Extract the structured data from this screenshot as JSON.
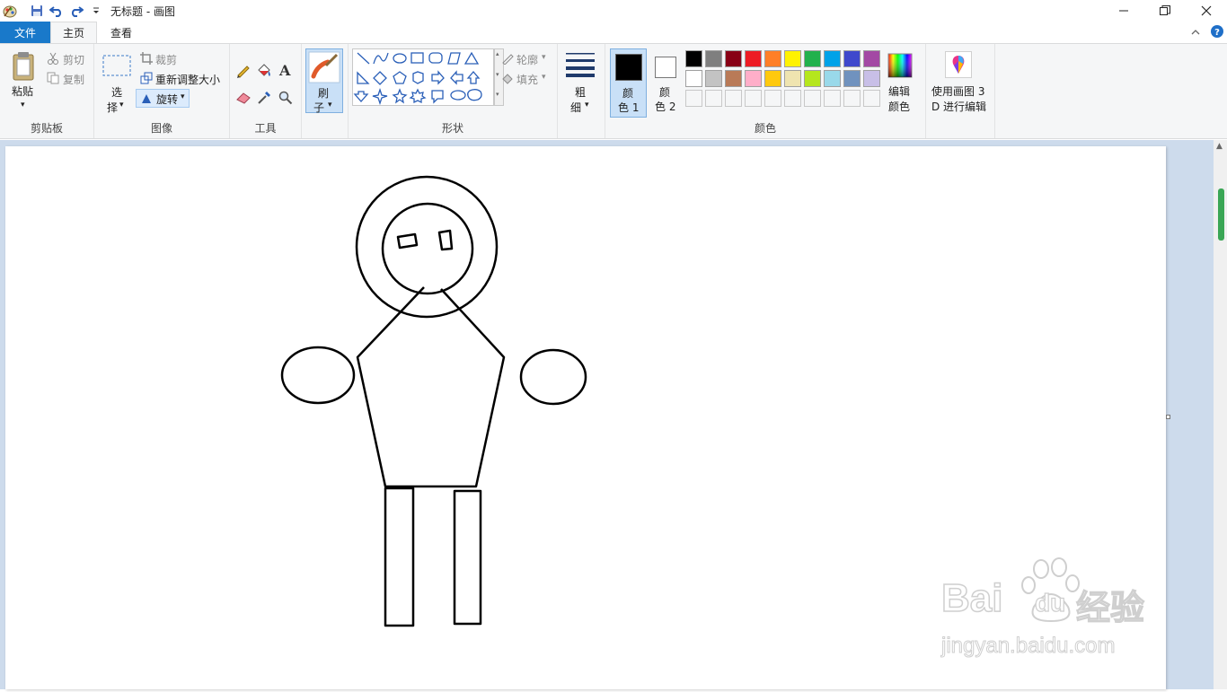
{
  "window": {
    "title": "无标题 - 画图"
  },
  "tabs": {
    "file": "文件",
    "home": "主页",
    "view": "查看"
  },
  "clipboard": {
    "paste": "粘贴",
    "cut": "剪切",
    "copy": "复制",
    "group_label": "剪贴板"
  },
  "image": {
    "select_1": "选",
    "select_2": "择",
    "crop": "裁剪",
    "resize": "重新调整大小",
    "rotate": "旋转",
    "group_label": "图像"
  },
  "tools": {
    "group_label": "工具"
  },
  "brushes": {
    "label_1": "刷",
    "label_2": "子"
  },
  "shapes": {
    "outline": "轮廓",
    "fill": "填充",
    "group_label": "形状"
  },
  "size": {
    "label_1": "粗",
    "label_2": "细"
  },
  "colors": {
    "color1_1": "颜",
    "color1_2": "色 1",
    "color2_1": "颜",
    "color2_2": "色 2",
    "edit_1": "编辑",
    "edit_2": "颜色",
    "group_label": "颜色",
    "color1_value": "#000000",
    "color2_value": "#ffffff",
    "palette_row1": [
      "#000000",
      "#7f7f7f",
      "#880015",
      "#ed1c24",
      "#ff7f27",
      "#fff200",
      "#22b14c",
      "#00a2e8",
      "#3f48cc",
      "#a349a4"
    ],
    "palette_row2": [
      "#ffffff",
      "#c3c3c3",
      "#b97a57",
      "#ffaec9",
      "#ffc90e",
      "#efe4b0",
      "#b5e61d",
      "#99d9ea",
      "#7092be",
      "#c8bfe7"
    ]
  },
  "paint3d": {
    "label_1": "使用画图 3",
    "label_2": "D 进行编辑"
  },
  "watermark": {
    "brand": "Bai",
    "brand2": "du",
    "cn": "经验",
    "url": "jingyan.baidu.com"
  }
}
